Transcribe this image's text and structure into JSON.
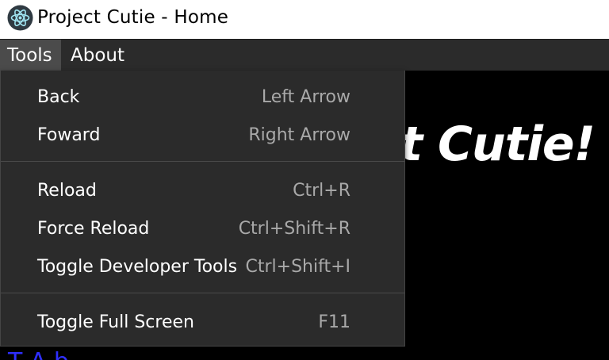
{
  "window": {
    "title": "Project Cutie - Home",
    "icon": "electron-atom-icon"
  },
  "menubar": {
    "items": [
      {
        "label": "Tools",
        "active": true
      },
      {
        "label": "About",
        "active": false
      }
    ]
  },
  "tools_menu": {
    "groups": [
      [
        {
          "label": "Back",
          "accelerator": "Left Arrow"
        },
        {
          "label": "Foward",
          "accelerator": "Right Arrow"
        }
      ],
      [
        {
          "label": "Reload",
          "accelerator": "Ctrl+R"
        },
        {
          "label": "Force Reload",
          "accelerator": "Ctrl+Shift+R"
        },
        {
          "label": "Toggle Developer Tools",
          "accelerator": "Ctrl+Shift+I"
        }
      ],
      [
        {
          "label": "Toggle Full Screen",
          "accelerator": "F11"
        }
      ]
    ]
  },
  "page": {
    "heading_visible": "ect Cutie!",
    "link_partial": "T    A b"
  },
  "colors": {
    "menubar_bg": "#2b2b2b",
    "menubar_active_bg": "#4b4b4b",
    "menu_bg": "#2b2b2b",
    "accelerator_text": "#a9a9a9",
    "page_bg": "#000000",
    "link": "#2f2fff"
  }
}
